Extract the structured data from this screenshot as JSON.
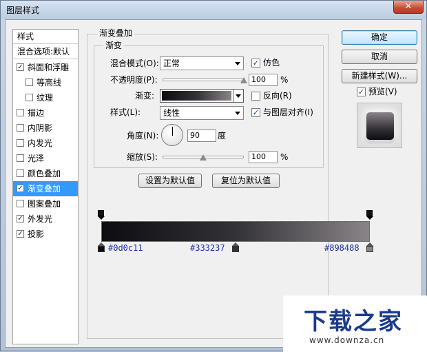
{
  "window": {
    "title": "图层样式",
    "close_glyph": "✕"
  },
  "sidebar": {
    "header": "样式",
    "blend_options": "混合选项:默认",
    "items": [
      {
        "label": "斜面和浮雕",
        "checked": true,
        "indent": false,
        "selected": false
      },
      {
        "label": "等高线",
        "checked": false,
        "indent": true,
        "selected": false
      },
      {
        "label": "纹理",
        "checked": false,
        "indent": true,
        "selected": false
      },
      {
        "label": "描边",
        "checked": false,
        "indent": false,
        "selected": false
      },
      {
        "label": "内阴影",
        "checked": false,
        "indent": false,
        "selected": false
      },
      {
        "label": "内发光",
        "checked": false,
        "indent": false,
        "selected": false
      },
      {
        "label": "光泽",
        "checked": false,
        "indent": false,
        "selected": false
      },
      {
        "label": "颜色叠加",
        "checked": false,
        "indent": false,
        "selected": false
      },
      {
        "label": "渐变叠加",
        "checked": true,
        "indent": false,
        "selected": true
      },
      {
        "label": "图案叠加",
        "checked": false,
        "indent": false,
        "selected": false
      },
      {
        "label": "外发光",
        "checked": true,
        "indent": false,
        "selected": false
      },
      {
        "label": "投影",
        "checked": true,
        "indent": false,
        "selected": false
      }
    ]
  },
  "panel": {
    "group_title": "渐变叠加",
    "sub_title": "渐变",
    "blend_mode_label": "混合模式(O):",
    "blend_mode_value": "正常",
    "dither_label": "仿色",
    "dither_checked": true,
    "opacity_label": "不透明度(P):",
    "opacity_value": "100",
    "opacity_unit": "%",
    "opacity_level": 1.0,
    "gradient_label": "渐变:",
    "reverse_label": "反向(R)",
    "reverse_checked": false,
    "style_label": "样式(L):",
    "style_value": "线性",
    "align_label": "与图层对齐(I)",
    "align_checked": true,
    "angle_label": "角度(N):",
    "angle_value": "90",
    "angle_unit": "度",
    "scale_label": "缩放(S):",
    "scale_value": "100",
    "scale_unit": "%",
    "scale_level": 0.5,
    "make_default": "设置为默认值",
    "reset_default": "复位为默认值",
    "check_glyph": "✓"
  },
  "buttons": {
    "ok": "确定",
    "cancel": "取消",
    "new_style": "新建样式(W)...",
    "preview_label": "预览(V)",
    "preview_checked": true
  },
  "gradient_editor": {
    "stops": [
      {
        "color": "#0d0c11",
        "position": 0.0
      },
      {
        "color": "#333237",
        "position": 0.5
      },
      {
        "color": "#898488",
        "position": 1.0
      }
    ],
    "labels": [
      "#0d0c11",
      "#333237",
      "#898488"
    ]
  },
  "watermark": {
    "logo": "下载之家",
    "url": "www.downza.cn"
  }
}
